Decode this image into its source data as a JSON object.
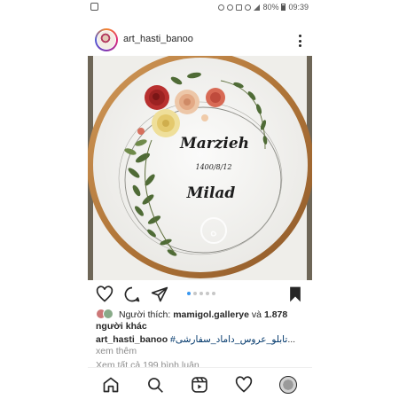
{
  "status_bar": {
    "battery": "80%",
    "time": "09:39"
  },
  "post": {
    "username": "art_hasti_banoo",
    "image": {
      "name_top": "Marzieh",
      "date": "1400/8/12",
      "name_bottom": "Milad",
      "watermark": "ه"
    },
    "carousel": {
      "count": 5,
      "active": 1
    },
    "likes": {
      "prefix": "Người thích:",
      "user": "mamigol.gallerye",
      "connector": "và",
      "count": "1.878",
      "suffix": "người khác"
    },
    "caption": {
      "username": "art_hasti_banoo",
      "hashtag": "#تابلو_عروس_داماد_سفارشی",
      "ellipsis": "...",
      "more": "xem thêm"
    },
    "view_comments": "Xem tất cả 199 bình luận"
  },
  "icons": {
    "like": "heart-icon",
    "comment": "comment-icon",
    "share": "send-icon",
    "save": "bookmark-icon",
    "home": "home-icon",
    "search": "search-icon",
    "reels": "reels-icon",
    "activity": "heart-icon",
    "profile": "profile-avatar"
  },
  "colors": {
    "text": "#262626",
    "link": "#00376b",
    "muted": "#8e8e8e",
    "carousel_active": "#3897f0",
    "hoop_wood": "#b9824a"
  }
}
